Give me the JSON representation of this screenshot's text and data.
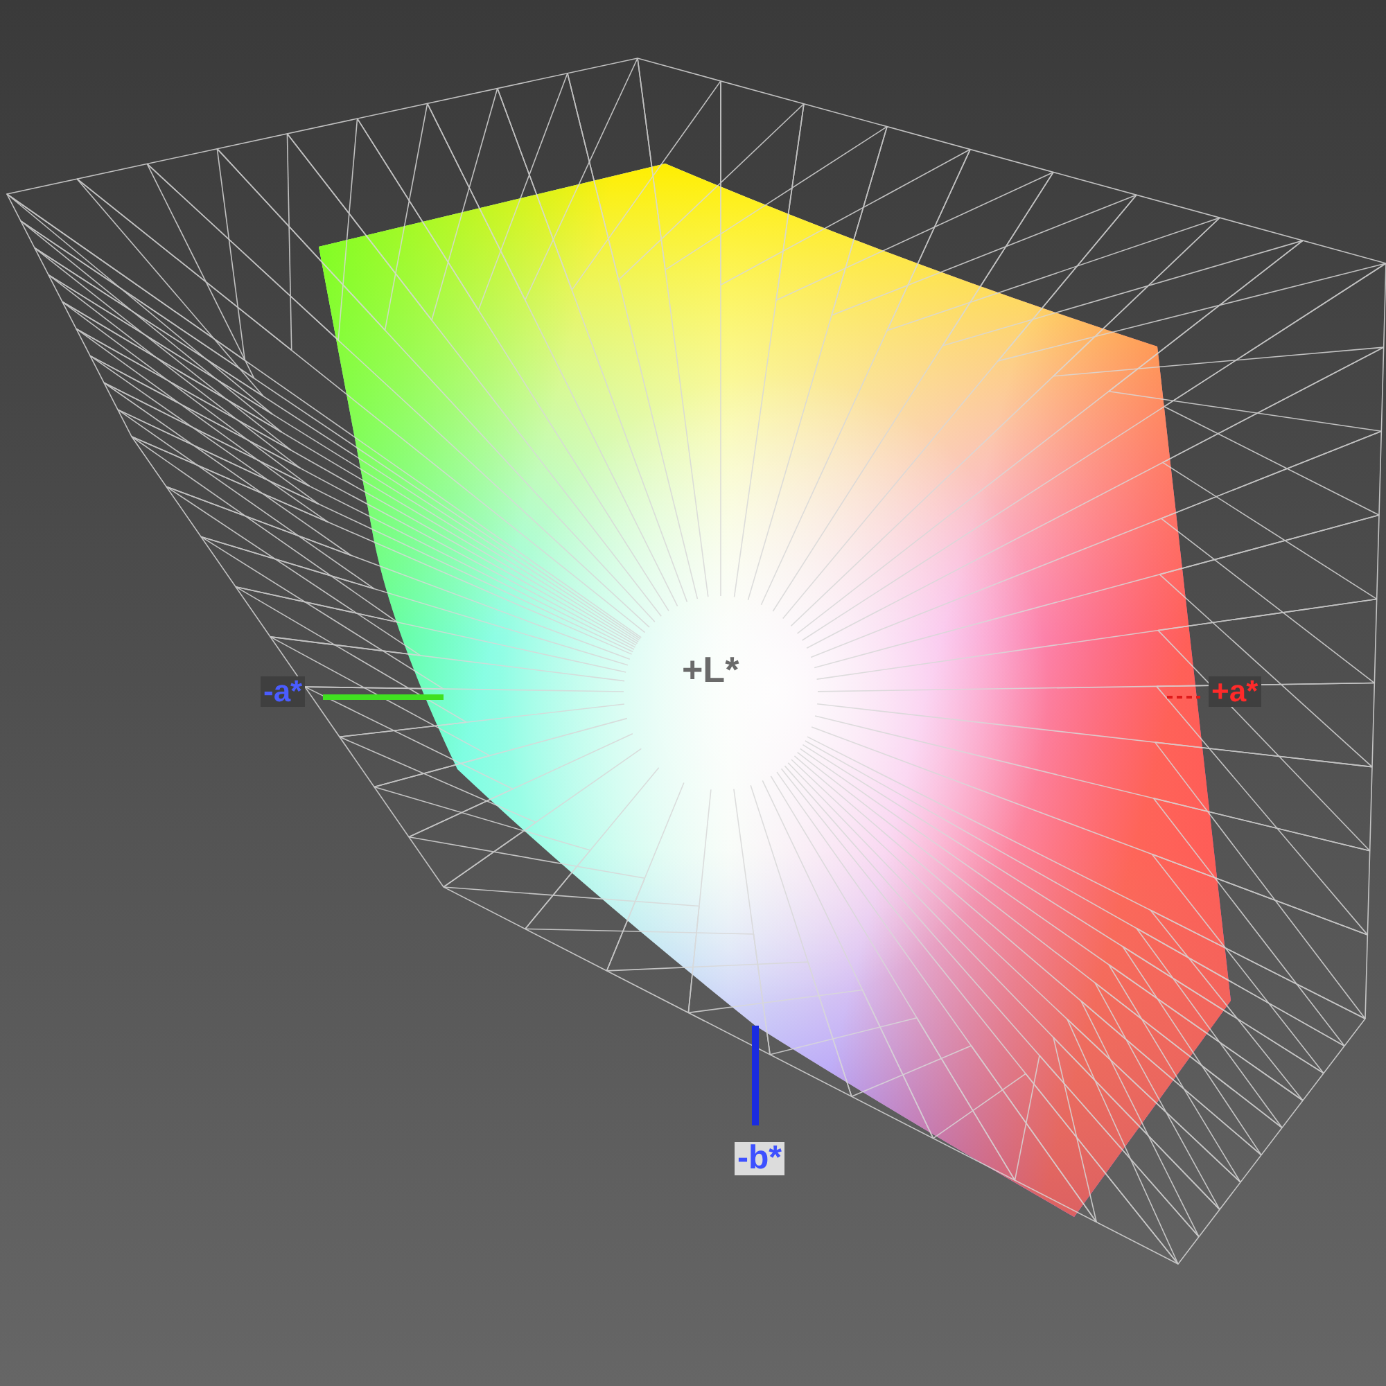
{
  "axis_labels": [
    {
      "text": "-a*",
      "color": "#4a5cff"
    },
    {
      "text": "+a*",
      "color": "#ff2a2a"
    },
    {
      "text": "-b*",
      "color": "#3d50ff"
    },
    {
      "text": "+L*",
      "color": "#6a6a6a"
    }
  ]
}
